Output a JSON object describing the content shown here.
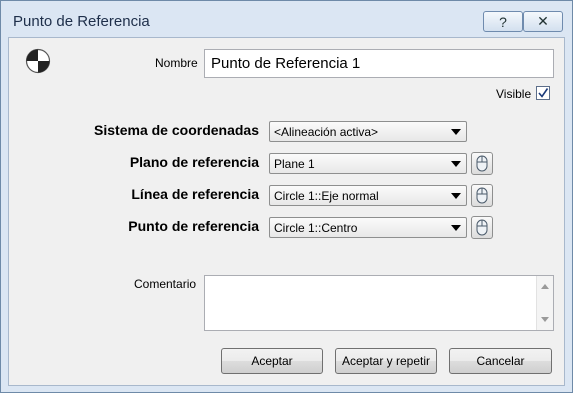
{
  "window": {
    "title": "Punto de Referencia",
    "help_glyph": "?",
    "close_glyph": "✕"
  },
  "header": {
    "icon": "reference-point-icon",
    "nombre_label": "Nombre",
    "nombre_value": "Punto de Referencia 1",
    "visible_label": "Visible",
    "visible_checked": true
  },
  "fields": [
    {
      "label": "Sistema de coordenadas",
      "value": "<Alineación activa>",
      "has_picker": false
    },
    {
      "label": "Plano de referencia",
      "value": "Plane 1",
      "has_picker": true
    },
    {
      "label": "Línea de referencia",
      "value": "Circle 1::Eje normal",
      "has_picker": true
    },
    {
      "label": "Punto de referencia",
      "value": "Circle 1::Centro",
      "has_picker": true
    }
  ],
  "comment": {
    "label": "Comentario",
    "value": ""
  },
  "buttons": {
    "ok": "Aceptar",
    "ok_repeat": "Aceptar y repetir",
    "cancel": "Cancelar"
  },
  "colors": {
    "frame": "#dbe6f3",
    "client": "#f0f0f0",
    "title_text": "#1e2f4a"
  }
}
